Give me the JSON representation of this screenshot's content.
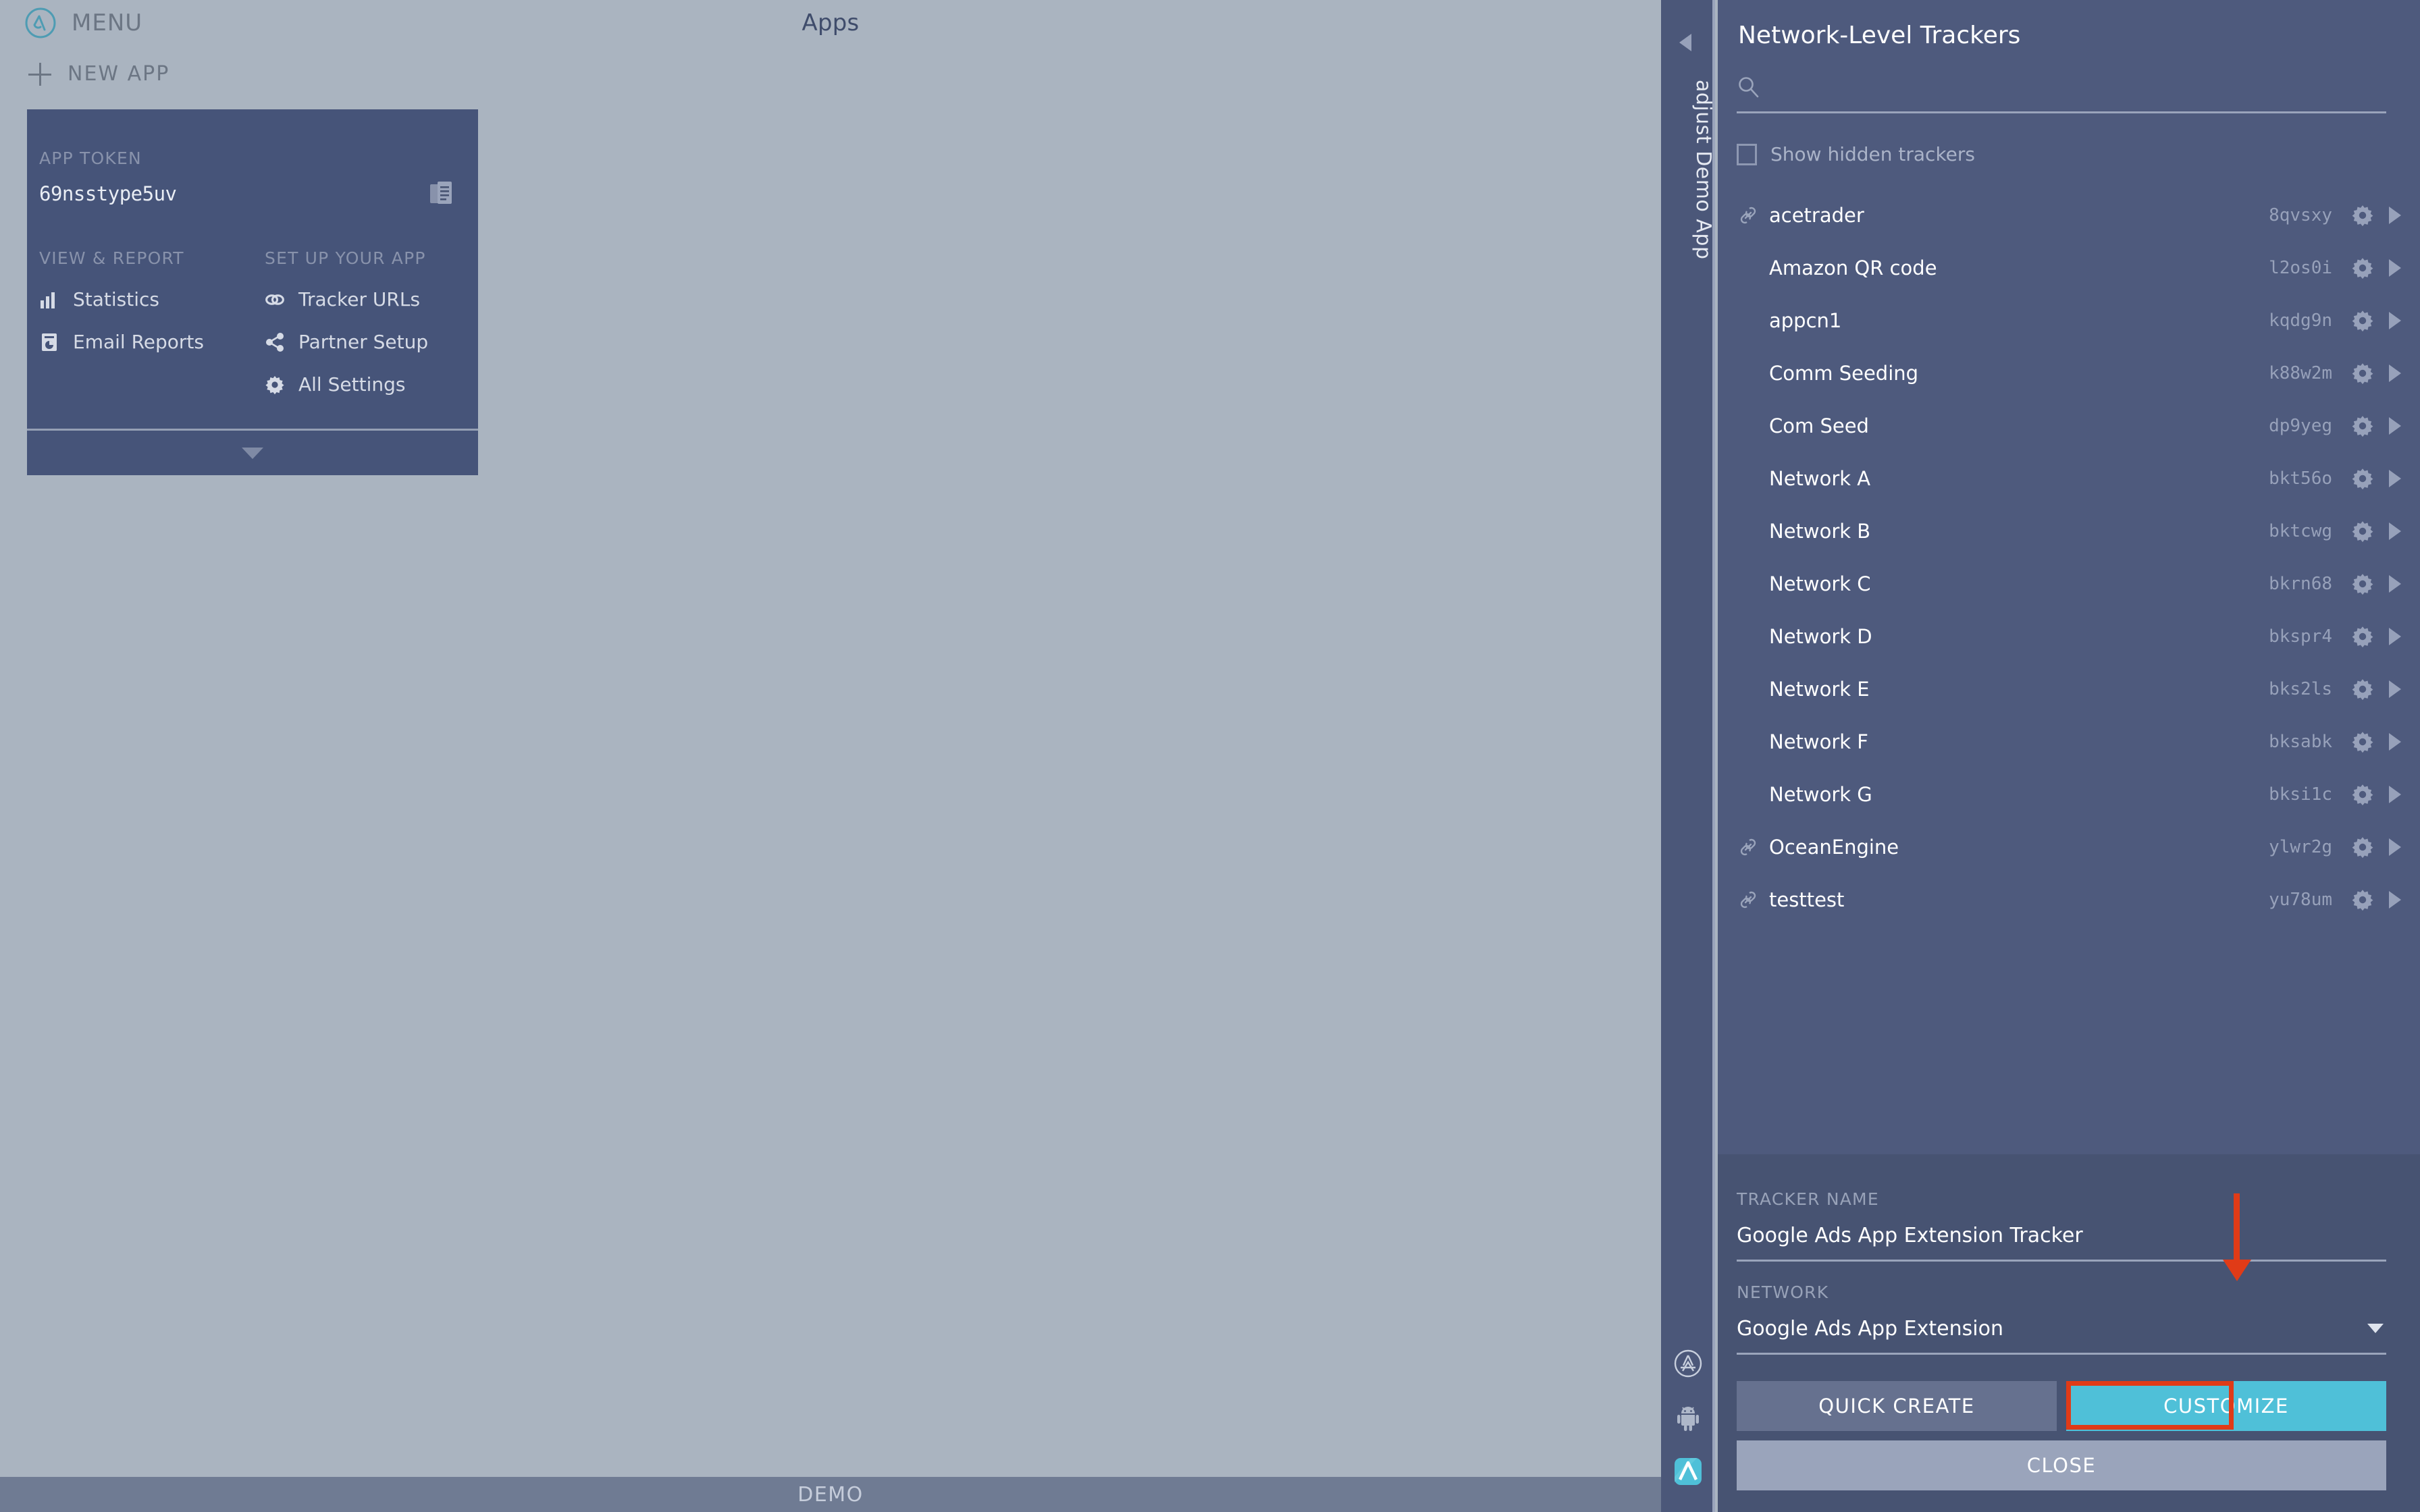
{
  "left": {
    "menu_label": "MENU",
    "logo_icon": "adjust-logo-icon",
    "apps_title": "Apps",
    "new_app_label": "NEW APP",
    "plus_icon": "plus-icon",
    "demo_bar_label": "DEMO",
    "app_card": {
      "token_label": "APP TOKEN",
      "token_value": "69nsstype5uv",
      "copy_icon": "copy-icon",
      "view_report_heading": "VIEW & REPORT",
      "setup_heading": "SET UP YOUR APP",
      "view_report_items": [
        {
          "label": "Statistics",
          "icon": "bar-chart-icon"
        },
        {
          "label": "Email Reports",
          "icon": "report-document-icon"
        }
      ],
      "setup_items": [
        {
          "label": "Tracker URLs",
          "icon": "link-chain-icon"
        },
        {
          "label": "Partner Setup",
          "icon": "share-nodes-icon"
        },
        {
          "label": "All Settings",
          "icon": "gear-icon"
        }
      ],
      "expander_icon": "chevron-down-icon"
    }
  },
  "app_strip": {
    "collapse_icon": "chevron-left-icon",
    "title": "adjust Demo App",
    "platform_icons": [
      {
        "name": "app-store-icon"
      },
      {
        "name": "android-icon"
      },
      {
        "name": "adjust-app-icon"
      }
    ]
  },
  "panel": {
    "title": "Network-Level Trackers",
    "search": {
      "icon": "search-icon",
      "value": "",
      "placeholder": ""
    },
    "show_hidden": {
      "label": "Show hidden trackers",
      "checked": false
    },
    "trackers": [
      {
        "name": "acetrader",
        "token": "8qvsxy",
        "linked": true,
        "gear_icon": "gear-icon",
        "expand_icon": "chevron-right-icon"
      },
      {
        "name": "Amazon QR code",
        "token": "l2os0i",
        "linked": false,
        "gear_icon": "gear-icon",
        "expand_icon": "chevron-right-icon"
      },
      {
        "name": "appcn1",
        "token": "kqdg9n",
        "linked": false,
        "gear_icon": "gear-icon",
        "expand_icon": "chevron-right-icon"
      },
      {
        "name": "Comm Seeding",
        "token": "k88w2m",
        "linked": false,
        "gear_icon": "gear-icon",
        "expand_icon": "chevron-right-icon"
      },
      {
        "name": "Com Seed",
        "token": "dp9yeg",
        "linked": false,
        "gear_icon": "gear-icon",
        "expand_icon": "chevron-right-icon"
      },
      {
        "name": "Network A",
        "token": "bkt56o",
        "linked": false,
        "gear_icon": "gear-icon",
        "expand_icon": "chevron-right-icon"
      },
      {
        "name": "Network B",
        "token": "bktcwg",
        "linked": false,
        "gear_icon": "gear-icon",
        "expand_icon": "chevron-right-icon"
      },
      {
        "name": "Network C",
        "token": "bkrn68",
        "linked": false,
        "gear_icon": "gear-icon",
        "expand_icon": "chevron-right-icon"
      },
      {
        "name": "Network D",
        "token": "bkspr4",
        "linked": false,
        "gear_icon": "gear-icon",
        "expand_icon": "chevron-right-icon"
      },
      {
        "name": "Network E",
        "token": "bks2ls",
        "linked": false,
        "gear_icon": "gear-icon",
        "expand_icon": "chevron-right-icon"
      },
      {
        "name": "Network F",
        "token": "bksabk",
        "linked": false,
        "gear_icon": "gear-icon",
        "expand_icon": "chevron-right-icon"
      },
      {
        "name": "Network G",
        "token": "bksi1c",
        "linked": false,
        "gear_icon": "gear-icon",
        "expand_icon": "chevron-right-icon"
      },
      {
        "name": "OceanEngine",
        "token": "ylwr2g",
        "linked": true,
        "gear_icon": "gear-icon",
        "expand_icon": "chevron-right-icon"
      },
      {
        "name": "testtest",
        "token": "yu78um",
        "linked": true,
        "gear_icon": "gear-icon",
        "expand_icon": "chevron-right-icon"
      }
    ],
    "form": {
      "tracker_name_label": "TRACKER NAME",
      "tracker_name_value": "Google Ads App Extension Tracker",
      "network_label": "NETWORK",
      "network_value": "Google Ads App Extension",
      "network_caret_icon": "chevron-down-icon",
      "quick_create_label": "QUICK CREATE",
      "customize_label": "CUSTOMIZE",
      "close_label": "CLOSE"
    }
  },
  "colors": {
    "page_bg": "#aab4c0",
    "panel_bg": "#4e5a7d",
    "form_bg": "#475372",
    "card_bg": "#465479",
    "accent_cyan": "#4fc0d8",
    "annotation_red": "#e03b17",
    "demo_bar": "#6f7b93"
  },
  "annotation": {
    "arrow_icon": "down-arrow-annotation",
    "highlight_box": "customize-button-highlight"
  }
}
